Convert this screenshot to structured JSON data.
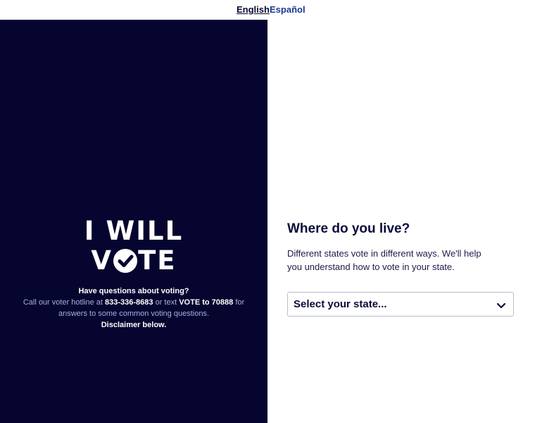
{
  "languages": {
    "english": "English",
    "spanish": "Español"
  },
  "logo": {
    "line1": "I WILL",
    "line2_left": "V",
    "line2_right": "TE"
  },
  "help": {
    "question": "Have questions about voting?",
    "call_prefix": "Call our voter hotline at",
    "phone": "833-336-8683",
    "or_text": "or text",
    "text_cmd": "VOTE to 70888",
    "suffix": "for answers to some common voting questions.",
    "disclaimer": "Disclaimer below."
  },
  "main": {
    "heading": "Where do you live?",
    "subtext": "Different states vote in different ways. We'll help you understand how to vote in your state.",
    "select_placeholder": "Select your state..."
  },
  "icons": {
    "logo_check": "check-circle-icon",
    "dropdown": "chevron-down-icon"
  },
  "colors": {
    "navy": "#06052f",
    "link": "#1a3a8f"
  }
}
